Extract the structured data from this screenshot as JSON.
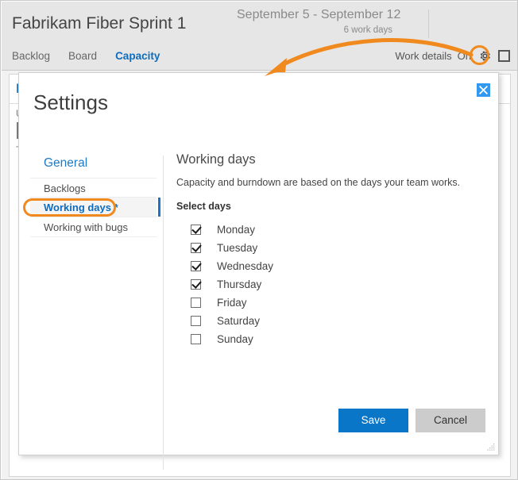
{
  "app": {
    "sprint_title": "Fabrikam Fiber Sprint 1",
    "date_range": "September 5 - September 12",
    "work_days": "6 work days",
    "tabs": [
      {
        "label": "Backlog",
        "active": false
      },
      {
        "label": "Board",
        "active": false
      },
      {
        "label": "Capacity",
        "active": true
      }
    ],
    "work_details_label": "Work details",
    "work_details_state": "On",
    "gear_icon": "gear-icon",
    "expand_icon": "fullscreen-icon",
    "background": {
      "heading": "F",
      "sub_text_1": "U",
      "sub_text_2": "T"
    }
  },
  "dialog": {
    "title": "Settings",
    "close_icon": "close-icon",
    "nav": {
      "group_title": "General",
      "items": [
        {
          "label": "Backlogs",
          "selected": false
        },
        {
          "label": "Working days *",
          "selected": true
        },
        {
          "label": "Working with bugs",
          "selected": false
        }
      ]
    },
    "content": {
      "title": "Working days",
      "description": "Capacity and burndown are based on the days your team works.",
      "subhead": "Select days",
      "days": [
        {
          "label": "Monday",
          "checked": true
        },
        {
          "label": "Tuesday",
          "checked": true
        },
        {
          "label": "Wednesday",
          "checked": true
        },
        {
          "label": "Thursday",
          "checked": true
        },
        {
          "label": "Friday",
          "checked": false
        },
        {
          "label": "Saturday",
          "checked": false
        },
        {
          "label": "Sunday",
          "checked": false
        }
      ]
    },
    "buttons": {
      "save": "Save",
      "cancel": "Cancel"
    },
    "resize_grip_icon": "resize-grip-icon"
  },
  "annotations": {
    "arrow_color": "#f08a1e",
    "gear_highlight": "circle-highlight",
    "nav_item_highlight": "rounded-rect-highlight"
  },
  "colors": {
    "accent_blue": "#0f6cbd",
    "primary_button": "#0a76c8",
    "annotation_orange": "#f08a1e",
    "header_bg": "#e6e6e6",
    "close_button": "#3399f0"
  }
}
